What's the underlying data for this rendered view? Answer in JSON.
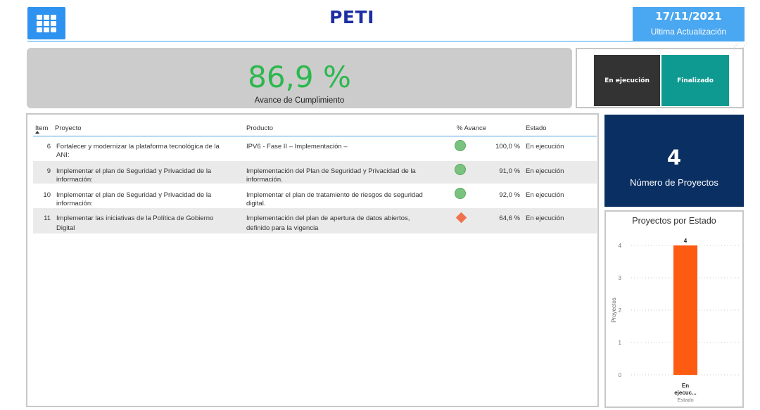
{
  "header": {
    "title": "PETI",
    "date": "17/11/2021",
    "update_label": "Ultima Actualización",
    "corner_mark": "⋰ ⋰"
  },
  "kpi": {
    "value": "86,9 %",
    "label": "Avance de Cumplimiento"
  },
  "slicer": {
    "options": [
      "En ejecución",
      "Finalizado"
    ]
  },
  "table": {
    "headers": [
      "Item",
      "Proyecto",
      "Producto",
      "% Avance",
      "Estado"
    ],
    "rows": [
      {
        "item": "6",
        "proyecto": [
          "Fortalecer y modernizar la plataforma tecnológica de la",
          "ANI:"
        ],
        "producto": [
          "IPV6 - Fase II – Implementación –",
          ""
        ],
        "indicator": "green-circle",
        "avance": "100,0 %",
        "estado": "En ejecución"
      },
      {
        "item": "9",
        "proyecto": [
          "Implementar el plan de Seguridad y Privacidad de la",
          "información:"
        ],
        "producto": [
          "Implementación del Plan de Seguridad y Privacidad de la",
          "información."
        ],
        "indicator": "green-circle",
        "avance": "91,0 %",
        "estado": "En ejecución"
      },
      {
        "item": "10",
        "proyecto": [
          "Implementar el plan de Seguridad y Privacidad de la",
          "información:"
        ],
        "producto": [
          "Implementar el plan de tratamiento de riesgos de seguridad",
          "digital."
        ],
        "indicator": "green-circle",
        "avance": "92,0 %",
        "estado": "En ejecución"
      },
      {
        "item": "11",
        "proyecto": [
          "Implementar las iniciativas de la Política de Gobierno",
          "Digital"
        ],
        "producto": [
          "Implementación del plan de apertura de datos abiertos,",
          "definido para la vigencia"
        ],
        "indicator": "red-diamond",
        "avance": "64,6 %",
        "estado": "En ejecución"
      }
    ]
  },
  "count_card": {
    "value": "4",
    "label": "Número de Proyectos"
  },
  "chart_data": {
    "type": "bar",
    "title": "Proyectos por Estado",
    "categories": [
      "En ejecuc..."
    ],
    "category_lines": [
      "En",
      "ejecuc..."
    ],
    "values": [
      4
    ],
    "data_labels": [
      "4"
    ],
    "xlabel": "Estado",
    "ylabel": "Proyectos",
    "ylim": [
      0,
      4
    ],
    "yticks": [
      0,
      1,
      2,
      3,
      4
    ],
    "grid": true,
    "bar_color": "#fd5a12"
  }
}
